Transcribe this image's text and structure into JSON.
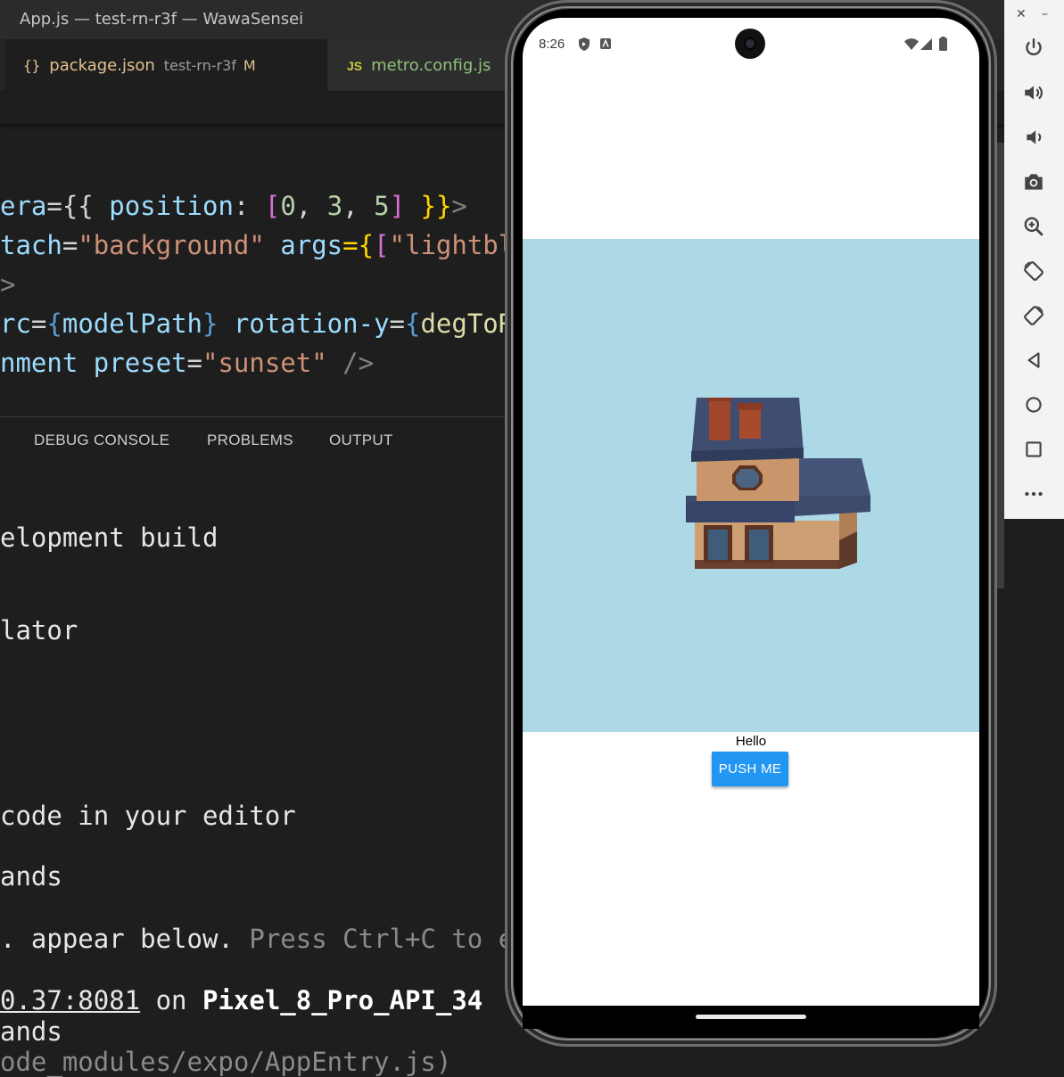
{
  "window": {
    "title": "App.js — test-rn-r3f — WawaSensei"
  },
  "tabs": [
    {
      "icon": "{}",
      "name": "package.json",
      "desc": "test-rn-r3f",
      "status": "M"
    },
    {
      "icon": "JS",
      "name": "metro.config.js"
    }
  ],
  "code": {
    "line1": {
      "a": "era",
      "b": "={{ ",
      "c": "position",
      "d": ": ",
      "e": "[",
      "f": "0",
      "g": ", ",
      "h": "3",
      "i": ", ",
      "j": "5",
      "k": "]",
      "l": " }}",
      "m": ">"
    },
    "line2": {
      "a": "tach",
      "b": "=",
      "c": "\"background\"",
      "d": " args",
      "e": "={",
      "f": "[",
      "g": "\"lightbl"
    },
    "line3": {
      "a": ">"
    },
    "line4": {
      "a": "rc",
      "b": "=",
      "c": "{",
      "d": "modelPath",
      "e": "}",
      "f": " rotation-y",
      "g": "=",
      "h": "{",
      "i": "degToR"
    },
    "line5": {
      "a": "nment",
      "b": " preset",
      "c": "=",
      "d": "\"sunset\"",
      "e": " />"
    }
  },
  "panel": {
    "tabs": [
      "DEBUG CONSOLE",
      "PROBLEMS",
      "OUTPUT"
    ]
  },
  "terminal": {
    "l1": "elopment build",
    "l2": "lator",
    "l3": "code in your editor",
    "l4": "ands",
    "l5a": ". appear below.",
    "l5b": " Press Ctrl+C to e",
    "l6a": "0.37:8081",
    "l6b": " on ",
    "l6c": "Pixel_8_Pro_API_34",
    "l7": "ands",
    "l8": "ode_modules/expo/AppEntry.js)"
  },
  "phone": {
    "time": "8:26",
    "hello_text": "Hello",
    "button_label": "PUSH ME",
    "canvas_bg": "#add8e6",
    "button_color": "#2196f3"
  },
  "emulator_toolbar": {
    "icons": [
      "power-icon",
      "volume-up-icon",
      "volume-down-icon",
      "camera-icon",
      "zoom-icon",
      "rotate-left-icon",
      "rotate-right-icon",
      "back-icon",
      "home-icon",
      "overview-icon",
      "more-icon"
    ]
  }
}
